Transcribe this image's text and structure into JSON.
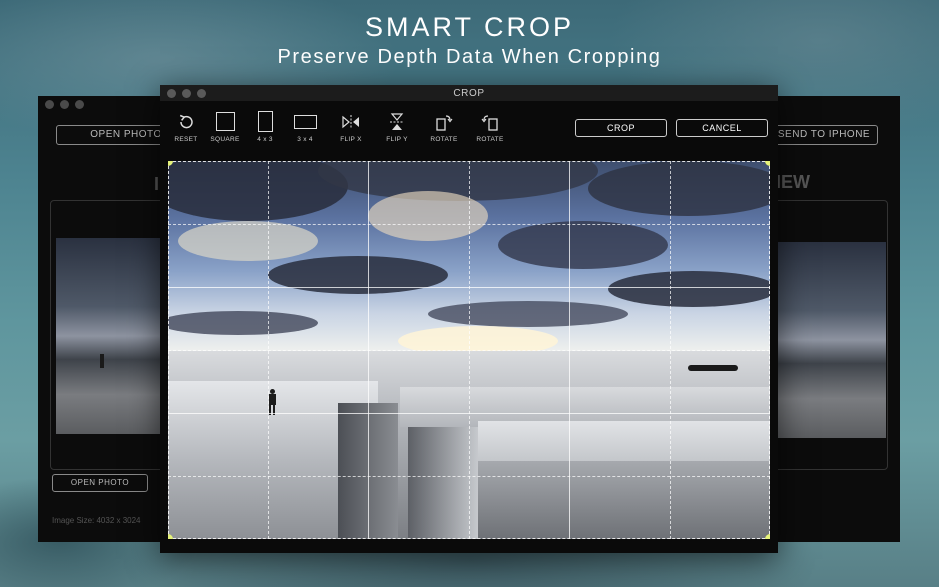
{
  "hero": {
    "title": "SMART CROP",
    "subtitle": "Preserve Depth Data When Cropping"
  },
  "background_left_window": {
    "open_photo_top": "OPEN PHOTO",
    "open_photo_bottom": "OPEN PHOTO",
    "title_fragment": "I",
    "image_size": "Image Size: 4032 x 3024"
  },
  "background_right_window": {
    "send_button": "SEND TO IPHONE",
    "title_fragment": "IEW"
  },
  "crop_window": {
    "title": "CROP",
    "tools": [
      {
        "label": "RESET",
        "icon": "reset-icon"
      },
      {
        "label": "SQUARE",
        "icon": "square-icon"
      },
      {
        "label": "4 x 3",
        "icon": "portrait-icon"
      },
      {
        "label": "3 x 4",
        "icon": "landscape-icon"
      },
      {
        "label": "FLIP X",
        "icon": "flip-x-icon"
      },
      {
        "label": "FLIP Y",
        "icon": "flip-y-icon"
      },
      {
        "label": "ROTATE",
        "icon": "rotate-right-icon"
      },
      {
        "label": "ROTATE",
        "icon": "rotate-left-icon"
      }
    ],
    "crop_button": "CROP",
    "cancel_button": "CANCEL"
  },
  "colors": {
    "handle": "#e5f27a",
    "window_bg": "#0a0a0a",
    "accent_text": "#ffffff"
  }
}
